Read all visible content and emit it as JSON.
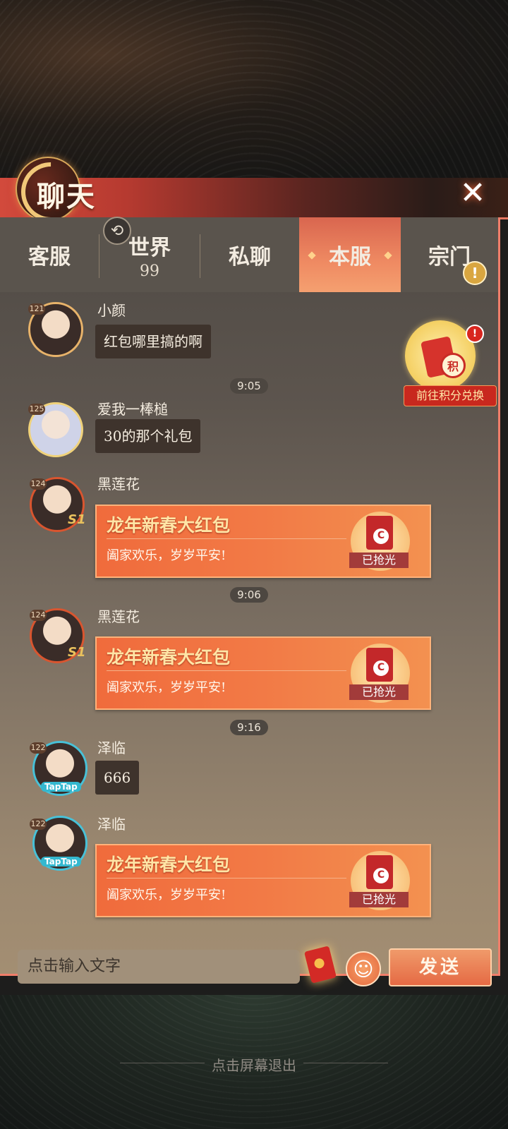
{
  "window": {
    "title": "聊天",
    "close_icon": "close-icon"
  },
  "tabs": [
    {
      "label": "客服",
      "badge": ""
    },
    {
      "label": "世界",
      "badge": "99"
    },
    {
      "label": "私聊",
      "badge": ""
    },
    {
      "label": "本服",
      "badge": "",
      "active": true
    },
    {
      "label": "宗门",
      "badge": ""
    }
  ],
  "messages": [
    {
      "type": "text",
      "level": "121",
      "name": "小颜",
      "text": "红包哪里搞的啊"
    },
    {
      "type": "time",
      "text": "9:05"
    },
    {
      "type": "text",
      "level": "125",
      "name": "爱我一棒槌",
      "text": "30的那个礼包"
    },
    {
      "type": "redpacket",
      "level": "124",
      "badge": "S1",
      "name": "黑莲花",
      "title": "龙年新春大红包",
      "subtitle": "阖家欢乐，岁岁平安!",
      "state": "已抢光"
    },
    {
      "type": "time",
      "text": "9:06"
    },
    {
      "type": "redpacket",
      "level": "124",
      "badge": "S1",
      "name": "黑莲花",
      "title": "龙年新春大红包",
      "subtitle": "阖家欢乐，岁岁平安!",
      "state": "已抢光"
    },
    {
      "type": "time",
      "text": "9:16"
    },
    {
      "type": "text",
      "level": "122",
      "badge": "TapTap",
      "name": "泽临",
      "text": "666"
    },
    {
      "type": "redpacket",
      "level": "122",
      "badge": "TapTap",
      "name": "泽临",
      "title": "龙年新春大红包",
      "subtitle": "阖家欢乐，岁岁平安!",
      "state": "已抢光"
    }
  ],
  "exchange": {
    "label": "前往积分兑换",
    "coin": "积",
    "alert": "!"
  },
  "input": {
    "placeholder": "点击输入文字",
    "send_label": "发送"
  },
  "footer": {
    "exit_hint": "点击屏幕退出"
  },
  "colors": {
    "accent": "#f06b3c",
    "tab_active": "#ef8a62",
    "header": "#d24a3c"
  }
}
